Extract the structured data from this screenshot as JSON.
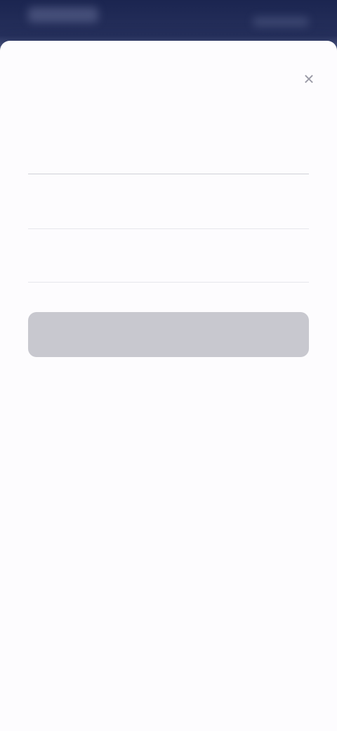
{
  "header": {
    "brand": "",
    "right_text": ""
  },
  "modal": {
    "close_label": "×",
    "title": "",
    "fields": {
      "name": {
        "label": "",
        "placeholder": ""
      },
      "phone": {
        "label": "",
        "placeholder": ""
      },
      "email": {
        "label": "",
        "placeholder": ""
      }
    },
    "submit_label": "",
    "note": ""
  },
  "colors": {
    "header_bg": "#1b2550",
    "button_disabled_bg": "#c8c8cf",
    "page_bg": "#fdfcfe"
  }
}
